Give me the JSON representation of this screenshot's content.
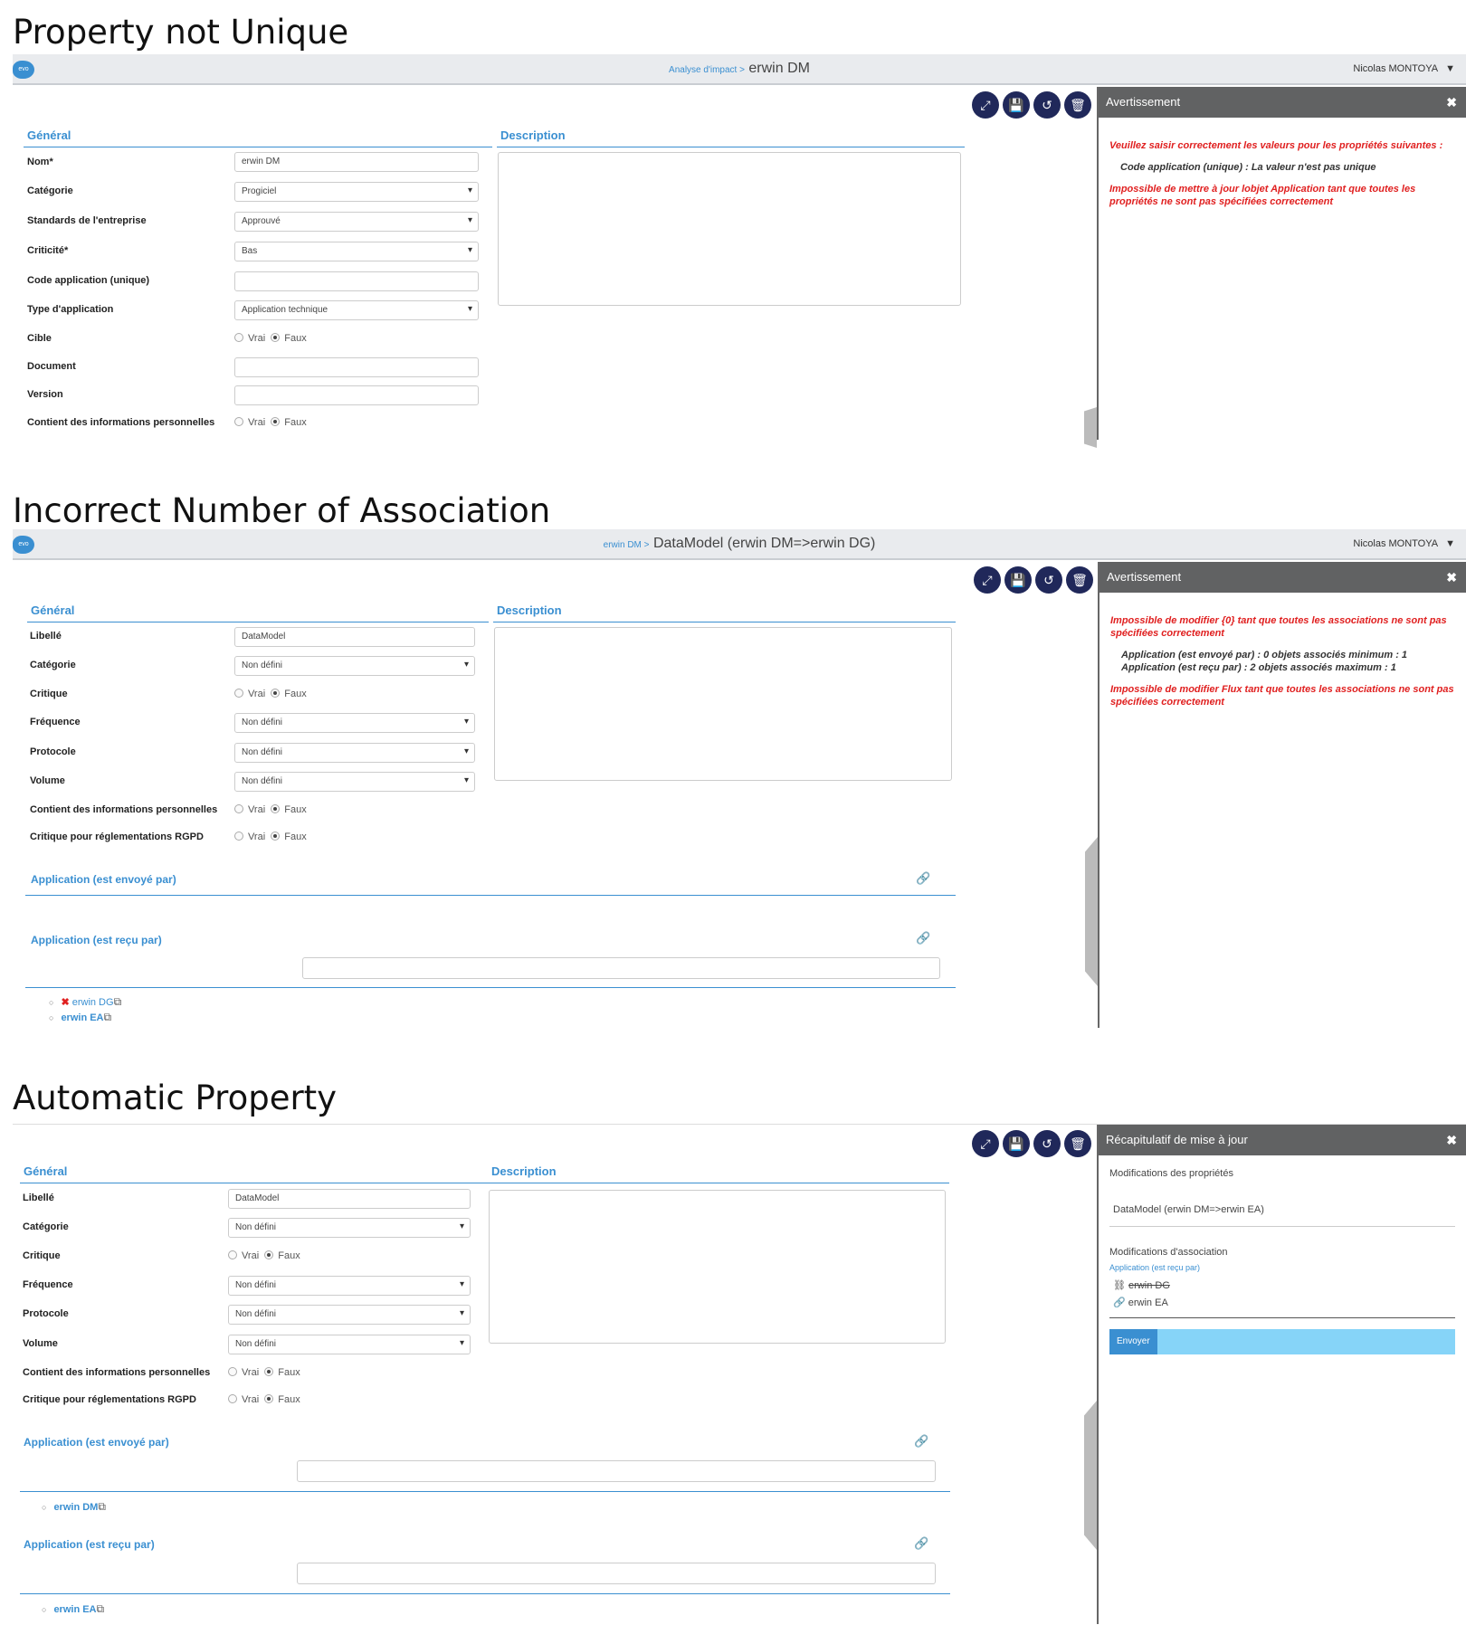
{
  "s1": {
    "title": "Property not Unique",
    "crumb_small": "Analyse d'impact >",
    "crumb_main": "erwin DM",
    "user": "Nicolas MONTOYA",
    "panel_title": "Avertissement",
    "msg1": "Veuillez saisir correctement les valeurs pour les propriétés suivantes :",
    "msg2": "Code application (unique) : La valeur n'est pas unique",
    "msg3": "Impossible de mettre à jour lobjet Application tant que toutes les propriétés ne sont pas spécifiées correctement",
    "general": "Général",
    "description": "Description",
    "labels": [
      "Nom*",
      "Catégorie",
      "Standards de l'entreprise",
      "Criticité*",
      "Code application (unique)",
      "Type d'application",
      "Cible",
      "Document",
      "Version",
      "Contient des informations personnelles"
    ],
    "values": [
      "erwin DM",
      "Progiciel",
      "Approuvé",
      "Bas",
      "",
      "Application technique",
      "",
      "",
      "",
      ""
    ],
    "vrai": "Vrai",
    "faux": "Faux"
  },
  "s2": {
    "title": "Incorrect Number of Association",
    "crumb_small": "erwin DM >",
    "crumb_main": "DataModel (erwin DM=>erwin DG)",
    "user": "Nicolas MONTOYA",
    "panel_title": "Avertissement",
    "msg1": "Impossible de modifier {0} tant que toutes les associations ne sont pas spécifiées correctement",
    "msg2a": "Application (est envoyé par) : 0 objets associés minimum : 1",
    "msg2b": "Application (est reçu par) : 2 objets associés maximum : 1",
    "msg3": "Impossible de modifier Flux tant que toutes les associations ne sont pas spécifiées correctement",
    "general": "Général",
    "description": "Description",
    "labels": [
      "Libellé",
      "Catégorie",
      "Critique",
      "Fréquence",
      "Protocole",
      "Volume",
      "Contient des informations personnelles",
      "Critique pour réglementations RGPD"
    ],
    "values": [
      "DataModel",
      "Non défini",
      "",
      "Non défini",
      "Non défini",
      "Non défini",
      "",
      ""
    ],
    "assoc1": "Application (est envoyé par)",
    "assoc2": "Application (est reçu par)",
    "items": [
      "erwin DG",
      "erwin EA"
    ],
    "vrai": "Vrai",
    "faux": "Faux"
  },
  "s3": {
    "title": "Automatic Property",
    "panel_title": "Récapitulatif de mise à jour",
    "mod_props": "Modifications des propriétés",
    "prop_val": "DataModel (erwin DM=>erwin EA)",
    "mod_assoc": "Modifications d'association",
    "assoc_small": "Application (est reçu par)",
    "removed": "erwin DG",
    "added": "erwin EA",
    "send": "Envoyer",
    "general": "Général",
    "description": "Description",
    "labels": [
      "Libellé",
      "Catégorie",
      "Critique",
      "Fréquence",
      "Protocole",
      "Volume",
      "Contient des informations personnelles",
      "Critique pour réglementations RGPD"
    ],
    "values": [
      "DataModel",
      "Non défini",
      "",
      "Non défini",
      "Non défini",
      "Non défini",
      "",
      ""
    ],
    "assoc1": "Application (est envoyé par)",
    "assoc2": "Application (est reçu par)",
    "item1": "erwin DM",
    "item2": "erwin EA",
    "vrai": "Vrai",
    "faux": "Faux"
  },
  "icons": [
    "expand-icon",
    "save-icon",
    "undo-icon",
    "trash-icon",
    "close-icon",
    "chevron-down-icon",
    "link-icon",
    "external-link-icon",
    "remove-icon",
    "unlink-icon"
  ]
}
